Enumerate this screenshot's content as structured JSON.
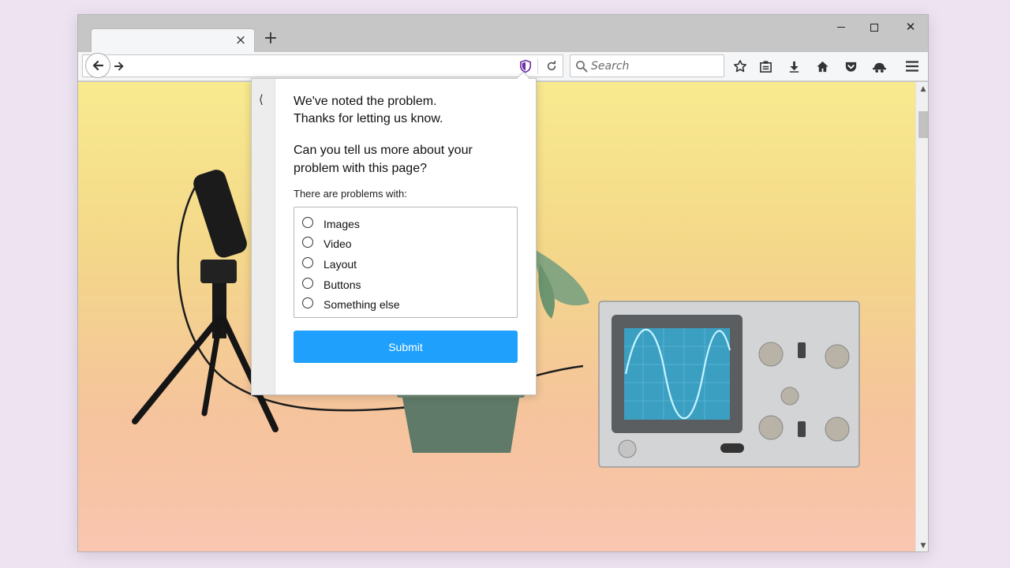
{
  "browser": {
    "tab": {
      "title": "",
      "close_glyph": "×"
    },
    "new_tab_glyph": "+",
    "window_controls": {
      "close_glyph": "✕"
    },
    "url": {
      "value": ""
    },
    "search": {
      "placeholder": "Search"
    },
    "toolbar_icons": [
      "bookmark-star-icon",
      "reading-list-icon",
      "download-icon",
      "home-icon",
      "pocket-icon",
      "sync-icon",
      "menu-icon"
    ]
  },
  "panel": {
    "back_glyph": "⟨",
    "heading_line1": "We've noted the problem.",
    "heading_line2": "Thanks for letting us know.",
    "question": "Can you tell us more about your problem with this page?",
    "problems_label": "There are problems with:",
    "options": [
      "Images",
      "Video",
      "Layout",
      "Buttons",
      "Something else"
    ],
    "submit_label": "Submit"
  },
  "colors": {
    "accent": "#1ea0fc",
    "shield": "#6e2fa5",
    "chrome": "#c6c6c6",
    "toolbar": "#f5f6f7"
  }
}
